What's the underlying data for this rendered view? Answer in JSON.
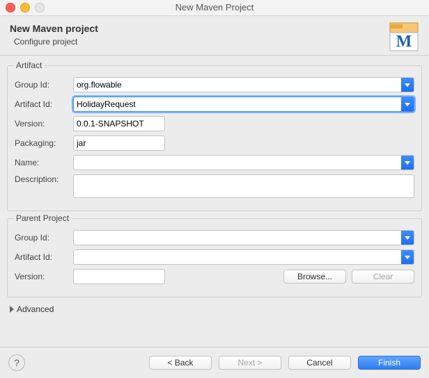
{
  "title": "New Maven Project",
  "header": {
    "title": "New Maven project",
    "subtitle": "Configure project"
  },
  "artifact": {
    "group_title": "Artifact",
    "labels": {
      "group_id": "Group Id:",
      "artifact_id": "Artifact Id:",
      "version": "Version:",
      "packaging": "Packaging:",
      "name": "Name:",
      "description": "Description:"
    },
    "values": {
      "group_id": "org.flowable",
      "artifact_id": "HolidayRequest",
      "version": "0.0.1-SNAPSHOT",
      "packaging": "jar",
      "name": "",
      "description": ""
    }
  },
  "parent": {
    "group_title": "Parent Project",
    "labels": {
      "group_id": "Group Id:",
      "artifact_id": "Artifact Id:",
      "version": "Version:"
    },
    "values": {
      "group_id": "",
      "artifact_id": "",
      "version": ""
    },
    "buttons": {
      "browse": "Browse...",
      "clear": "Clear"
    }
  },
  "advanced": {
    "label": "Advanced"
  },
  "footer": {
    "back": "< Back",
    "next": "Next >",
    "cancel": "Cancel",
    "finish": "Finish"
  }
}
